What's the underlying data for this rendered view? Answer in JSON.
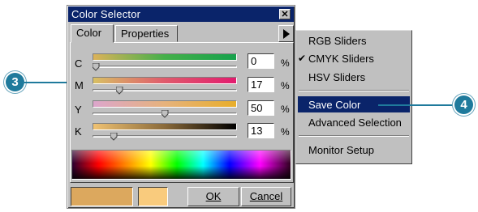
{
  "window": {
    "title": "Color Selector",
    "close_glyph": "✕"
  },
  "tabs": [
    {
      "label": "Color"
    },
    {
      "label": "Properties"
    }
  ],
  "sliders": [
    {
      "label": "C",
      "value": "0",
      "unit": "%",
      "level": 0.0
    },
    {
      "label": "M",
      "value": "17",
      "unit": "%",
      "level": 0.17
    },
    {
      "label": "Y",
      "value": "50",
      "unit": "%",
      "level": 0.5
    },
    {
      "label": "K",
      "value": "13",
      "unit": "%",
      "level": 0.13
    }
  ],
  "buttons": {
    "ok": "OK",
    "cancel": "Cancel"
  },
  "swatches": {
    "current": "#dca85e",
    "previous": "#f9cb7d"
  },
  "menu": {
    "items": [
      {
        "label": "RGB Sliders",
        "checked": false
      },
      {
        "label": "CMYK Sliders",
        "checked": true
      },
      {
        "label": "HSV Sliders",
        "checked": false
      },
      {
        "label": "Save Color",
        "highlighted": true
      },
      {
        "label": "Advanced Selection"
      },
      {
        "label": "Monitor Setup"
      }
    ],
    "check_glyph": "✔"
  },
  "callouts": {
    "left": "3",
    "right": "4"
  },
  "colors": {
    "title_bar": "#0a246a",
    "highlight": "#0a246a",
    "callout": "#1f7a9c"
  }
}
